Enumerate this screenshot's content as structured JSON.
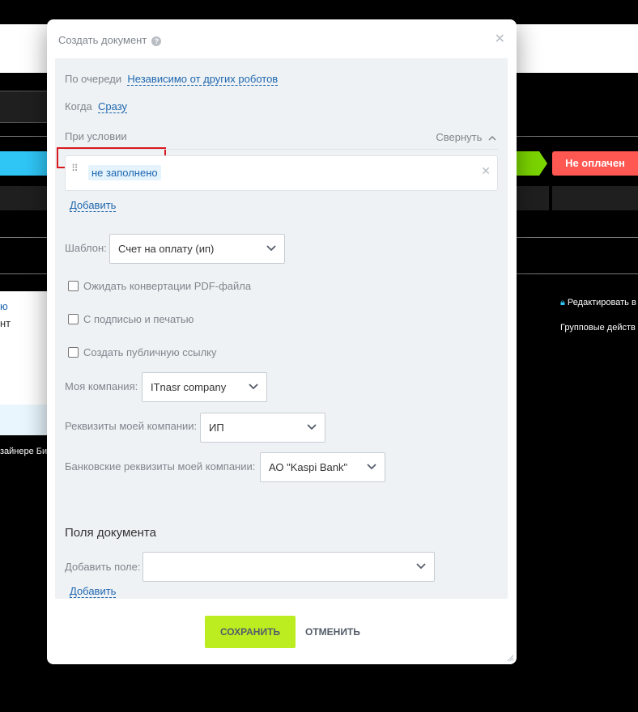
{
  "background": {
    "status_badge": "Не оплачен",
    "left_snippets": [
      "ю",
      "нт"
    ],
    "left_caption": "зайнере Би",
    "right_links": [
      "Редактировать в",
      "Групповые действ"
    ]
  },
  "modal": {
    "title": "Создать документ",
    "help_icon": "question-circle-icon",
    "close_icon": "close-icon",
    "queue": {
      "label": "По очереди",
      "value": "Независимо от других роботов"
    },
    "when": {
      "label": "Когда",
      "value": "Сразу"
    },
    "condition": {
      "label": "При условии",
      "collapse_label": "Свернуть",
      "item": "не заполнено",
      "add_label": "Добавить"
    },
    "template": {
      "label": "Шаблон:",
      "value": "Счет на оплату (ип)"
    },
    "checkboxes": [
      {
        "label": "Ожидать конвертации PDF-файла",
        "checked": false
      },
      {
        "label": "С подписью и печатью",
        "checked": false
      },
      {
        "label": "Создать публичную ссылку",
        "checked": false
      }
    ],
    "my_company": {
      "label": "Моя компания:",
      "value": "ITnasr company"
    },
    "company_requisites": {
      "label": "Реквизиты моей компании:",
      "value": "ИП"
    },
    "bank_requisites": {
      "label": "Банковские реквизиты моей компании:",
      "value": "АО \"Kaspi Bank\""
    },
    "document_fields": {
      "title": "Поля документа",
      "add_field_label": "Добавить поле:",
      "add_field_value": "",
      "add_label": "Добавить"
    },
    "buttons": {
      "save": "СОХРАНИТЬ",
      "cancel": "ОТМЕНИТЬ"
    }
  },
  "colors": {
    "accent_link": "#2067b0",
    "save_button": "#bbed21",
    "status_red": "#ff5752",
    "status_green": "#7bd500",
    "stage_blue": "#2fc6f6",
    "highlight": "#d9191f"
  }
}
